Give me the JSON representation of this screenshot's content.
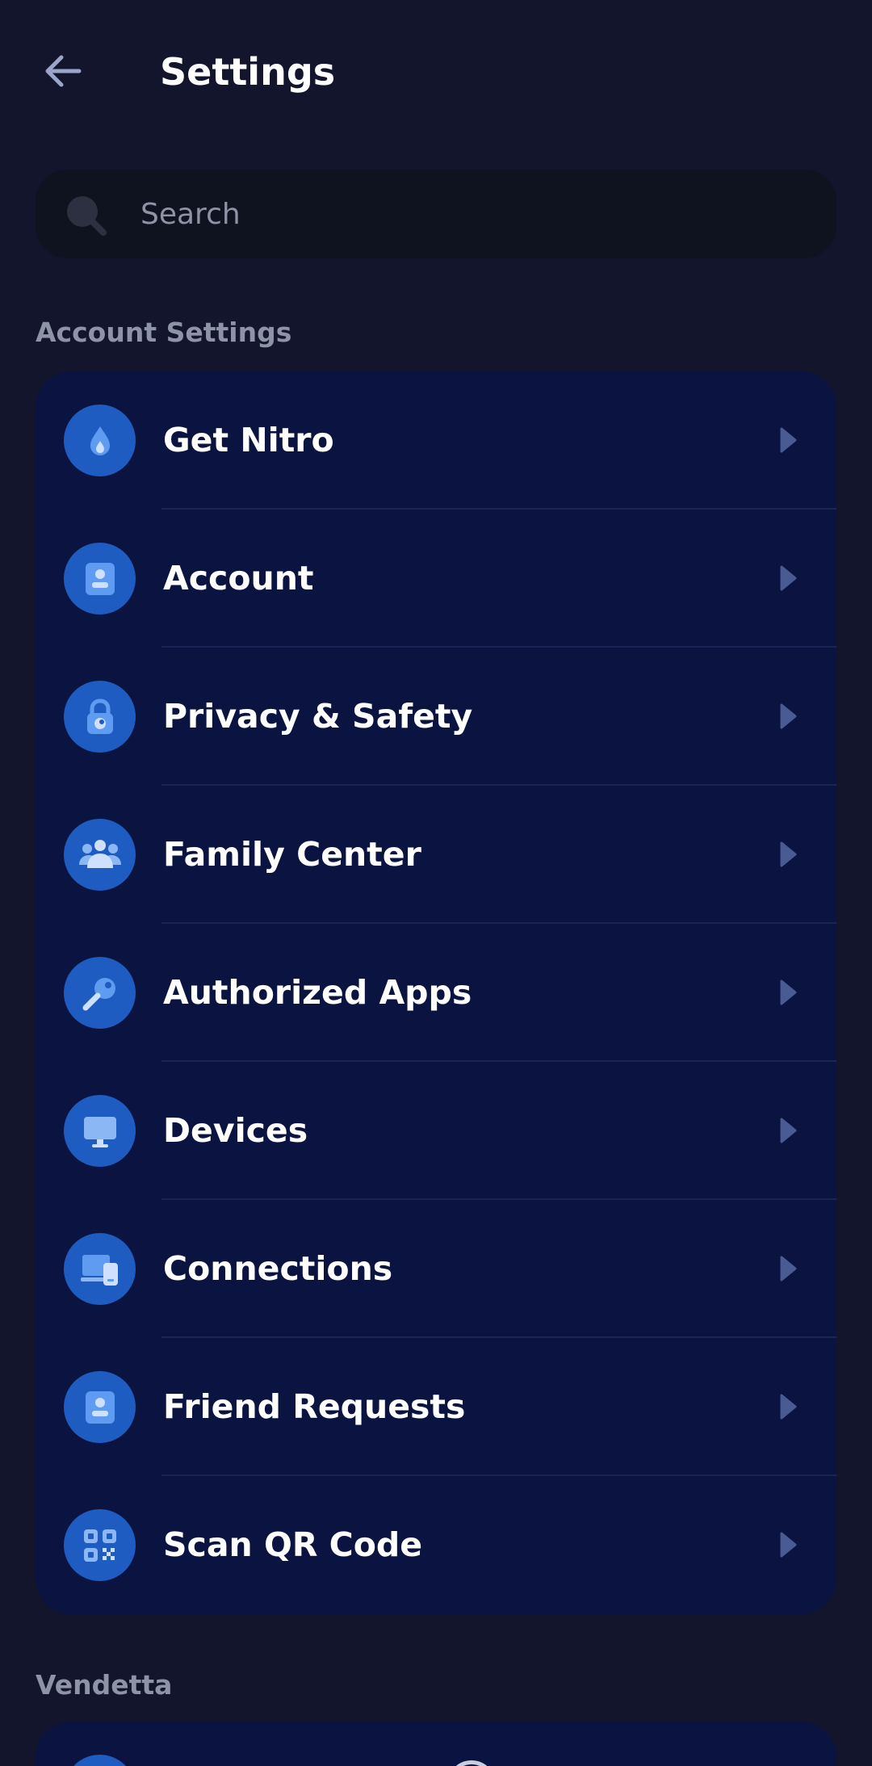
{
  "header": {
    "title": "Settings",
    "back_icon": "arrow-left-icon"
  },
  "search": {
    "placeholder": "Search",
    "value": "",
    "icon": "search-icon"
  },
  "sections": [
    {
      "label": "Account Settings",
      "items": [
        {
          "label": "Get Nitro",
          "icon": "nitro-icon"
        },
        {
          "label": "Account",
          "icon": "account-icon"
        },
        {
          "label": "Privacy & Safety",
          "icon": "lock-icon"
        },
        {
          "label": "Family Center",
          "icon": "family-icon"
        },
        {
          "label": "Authorized Apps",
          "icon": "key-icon"
        },
        {
          "label": "Devices",
          "icon": "monitor-icon"
        },
        {
          "label": "Connections",
          "icon": "connections-icon"
        },
        {
          "label": "Friend Requests",
          "icon": "friend-requests-icon"
        },
        {
          "label": "Scan QR Code",
          "icon": "qr-code-icon"
        }
      ]
    },
    {
      "label": "Vendetta",
      "items": []
    }
  ],
  "colors": {
    "background": "#12152b",
    "card": "#0b1440",
    "icon_circle": "#1f5cc2",
    "icon_glyph": "#6fa4ee",
    "section_label": "#8f93a8",
    "chevron": "#5b6fa8"
  }
}
